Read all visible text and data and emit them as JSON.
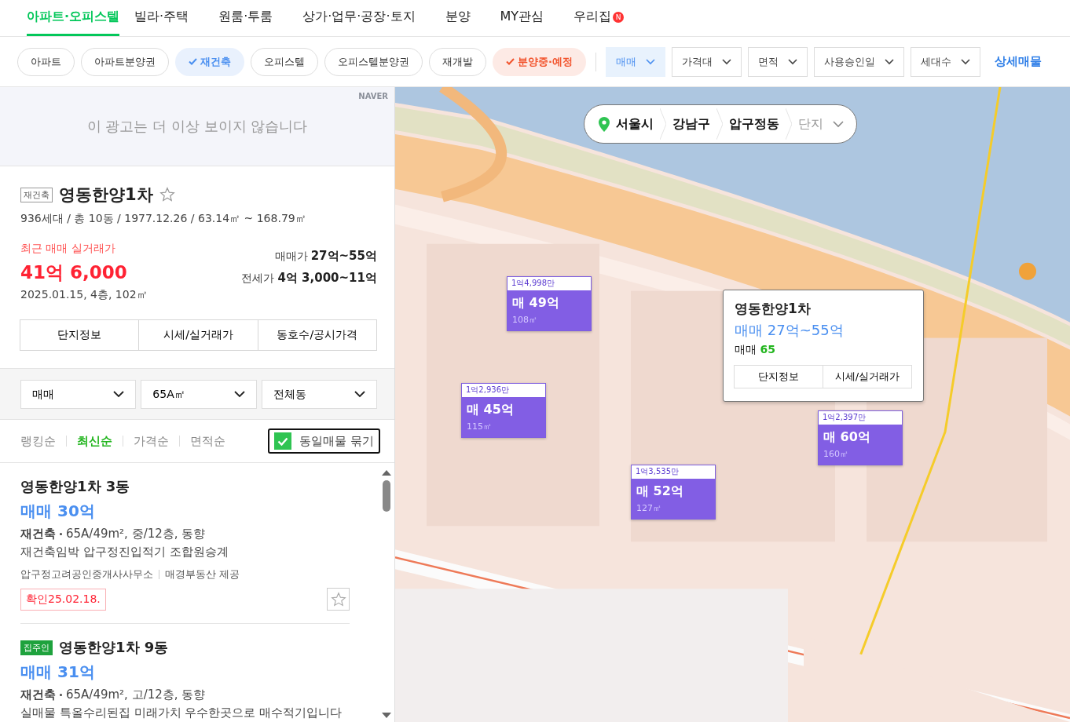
{
  "top_tabs": [
    {
      "label": "아파트·오피스텔",
      "selected": true
    },
    {
      "label": "빌라·주택",
      "selected": false
    },
    {
      "label": "원룸·투룸",
      "selected": false
    },
    {
      "label": "상가·업무·공장·토지",
      "selected": false
    },
    {
      "label": "분양",
      "selected": false
    },
    {
      "label": "MY관심",
      "selected": false
    },
    {
      "label": "우리집",
      "selected": false,
      "badge": "N"
    }
  ],
  "chips": [
    {
      "label": "아파트",
      "checked": false
    },
    {
      "label": "아파트분양권",
      "checked": false
    },
    {
      "label": "재건축",
      "checked": true,
      "color": "#4a8ff0"
    },
    {
      "label": "오피스텔",
      "checked": false
    },
    {
      "label": "오피스텔분양권",
      "checked": false
    },
    {
      "label": "재개발",
      "checked": false
    },
    {
      "label": "분양중·예정",
      "checked": true,
      "color": "#f2542d"
    }
  ],
  "dropdowns": [
    {
      "label": "매매",
      "selected": true
    },
    {
      "label": "가격대",
      "selected": false
    },
    {
      "label": "면적",
      "selected": false
    },
    {
      "label": "사용승인일",
      "selected": false
    },
    {
      "label": "세대수",
      "selected": false
    }
  ],
  "detail_search": "상세매물",
  "ad": {
    "text": "이 광고는 더 이상 보이지 않습니다",
    "brand": "NAVER"
  },
  "complex": {
    "tag": "재건축",
    "name": "영동한양1차",
    "favorite": false,
    "info": "936세대 / 총 10동 / 1977.12.26 / 63.14㎡ ~ 168.79㎡",
    "recent_label": "최근 매매 실거래가",
    "recent_price": "41억 6,000",
    "recent_detail": "2025.01.15, 4층, 102㎡",
    "price_ranges": [
      {
        "label": "매매가",
        "value": "27억~55억"
      },
      {
        "label": "전세가",
        "value": "4억 3,000~11억"
      }
    ],
    "buttons": [
      "단지정보",
      "시세/실거래가",
      "동호수/공시가격"
    ]
  },
  "list_selects": [
    "매매",
    "65A㎡",
    "전체동"
  ],
  "sorts": [
    {
      "label": "랭킹순",
      "selected": false
    },
    {
      "label": "최신순",
      "selected": true
    },
    {
      "label": "가격순",
      "selected": false
    },
    {
      "label": "면적순",
      "selected": false
    }
  ],
  "group_same": {
    "label": "동일매물 묶기",
    "checked": true
  },
  "listings": [
    {
      "title": "영동한양1차 3동",
      "price": "매매 30억",
      "type": "재건축",
      "spec": "65A/49m², 중/12층, 동향",
      "desc": "재건축임박 압구정진입적기 조합원승계",
      "agent": "압구정고려공인중개사사무소",
      "source": "매경부동산 제공",
      "confirmed": "확인25.02.18.",
      "favorite": false
    },
    {
      "tag": "집주인",
      "title": "영동한양1차 9동",
      "price": "매매 31억",
      "type": "재건축",
      "spec": "65A/49m², 고/12층, 동향",
      "desc": "실매물 특올수리된집 미래가치 우수한곳으로 매수적기입니다"
    }
  ],
  "map": {
    "breadcrumb": [
      "서울시",
      "강남구",
      "압구정동"
    ],
    "breadcrumb_placeholder": "단지",
    "markers": [
      {
        "top": "1억4,998만",
        "price": "매 49억",
        "area": "108㎡"
      },
      {
        "top": "1억2,936만",
        "price": "매 45억",
        "area": "115㎡"
      },
      {
        "top": "1억3,535만",
        "price": "매 52억",
        "area": "127㎡"
      },
      {
        "top": "1억2,397만",
        "price": "매 60억",
        "area": "160㎡"
      }
    ],
    "popup": {
      "title": "영동한양1차",
      "price": "매매 27억~55억",
      "count_label": "매매",
      "count": "65",
      "buttons": [
        "단지정보",
        "시세/실거래가"
      ]
    }
  }
}
